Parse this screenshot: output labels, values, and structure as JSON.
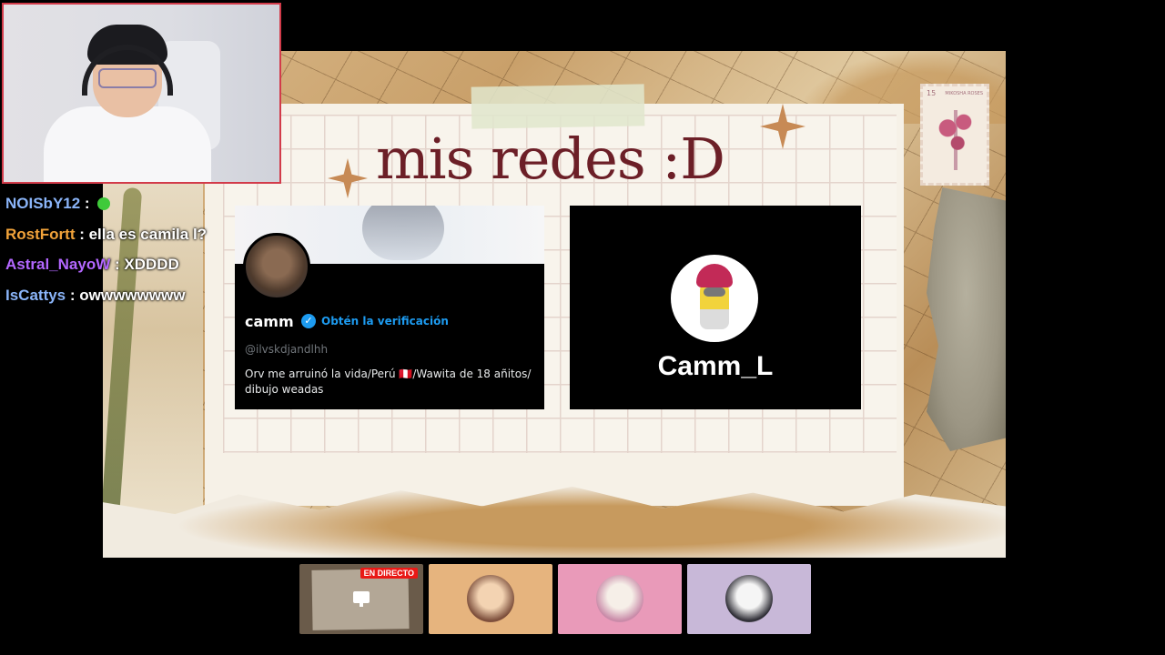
{
  "slide": {
    "title": "mis redes :D",
    "stamp": {
      "value": "15",
      "name": "MIKOSHA ROSES"
    }
  },
  "twitter_card": {
    "name": "camm",
    "verify_label": "Obtén la verificación",
    "handle": "@ilvskdjandlhh",
    "bio": "Orv me arruinó la vida/Perú 🇵🇪/Wawita de 18 añitos/ dibujo weadas",
    "verified_color": "#1d9bf0"
  },
  "tiktok_card": {
    "username": "Camm_L"
  },
  "chat": {
    "messages": [
      {
        "user": "NOISbY12",
        "user_color": "#8ab4f8",
        "text": ""
      },
      {
        "user": "RostFortt",
        "user_color": "#f2a33a",
        "text": "ella es camila l?"
      },
      {
        "user": "Astral_NayoW",
        "user_color": "#b367ff",
        "text": "XDDDD"
      },
      {
        "user": "IsCattys",
        "user_color": "#8ab4f8",
        "text": "owwwwwwww"
      }
    ]
  },
  "participants": {
    "live_badge": "EN DIRECTO",
    "tiles": [
      {
        "name": "screen-share",
        "bg": "#6a5b4a"
      },
      {
        "name": "participant-2",
        "bg": "#e6b47e"
      },
      {
        "name": "participant-3",
        "bg": "#e99ab9"
      },
      {
        "name": "participant-4",
        "bg": "#c8b8d8"
      }
    ]
  },
  "colors": {
    "title": "#6c1f27",
    "webcam_border": "#d23b4a",
    "live_badge": "#e91916"
  }
}
